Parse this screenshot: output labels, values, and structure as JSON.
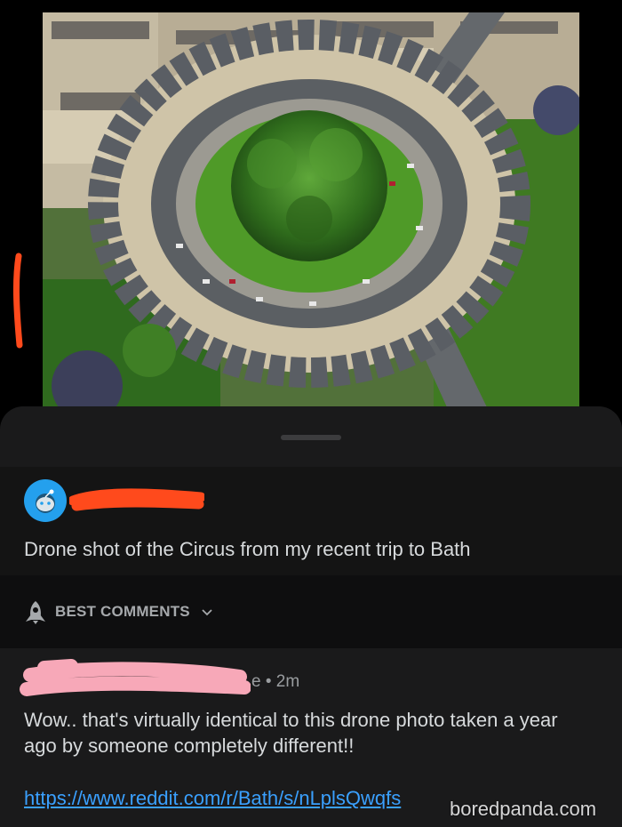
{
  "image": {
    "subject": "aerial-drone-photo",
    "colors": {
      "foliage": "#3f7a22",
      "lawn": "#4f9a28",
      "road": "#5b5f63",
      "stone": "#cfc4a8",
      "roof": "#565a60"
    }
  },
  "annotations": {
    "scribble_color": "#ff4a1c",
    "scribble_pink": "#f7a8b8"
  },
  "post": {
    "title": "Drone shot of the Circus from my recent trip to Bath"
  },
  "sort": {
    "label": "BEST COMMENTS",
    "icon": "rocket-icon"
  },
  "comment": {
    "time": "e • 2m",
    "body": "Wow.. that's virtually identical to this drone photo taken a year ago by someone completely different!!",
    "link": "https://www.reddit.com/r/Bath/s/nLplsQwqfs"
  },
  "watermark": "boredpanda.com",
  "colors": {
    "sheet_bg": "#1a1a1b",
    "text": "#d7dadc",
    "link": "#3aa0ff",
    "avatar_bg": "#24a0ed"
  }
}
